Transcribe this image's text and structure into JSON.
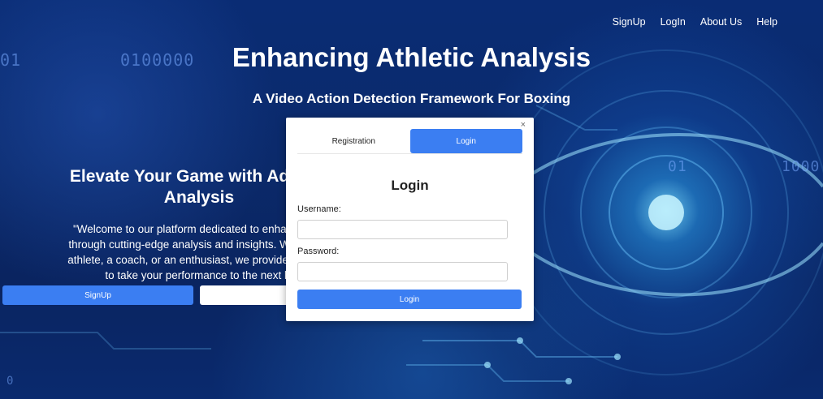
{
  "nav": {
    "items": [
      {
        "label": "SignUp"
      },
      {
        "label": "LogIn"
      },
      {
        "label": "About Us"
      },
      {
        "label": "Help"
      }
    ]
  },
  "header": {
    "title": "Enhancing Athletic Analysis",
    "subtitle": "A Video Action Detection Framework For Boxing"
  },
  "hero": {
    "heading_line1": "Elevate Your Game with Advanc",
    "heading_line2": "Analysis",
    "text_lines": [
      "\"Welcome to our platform dedicated to enhancing at",
      "through cutting-edge analysis and insights. Whether y",
      "athlete, a coach, or an enthusiast, we provide powerfu",
      "to take your performance to the next le"
    ],
    "signup_button": "SignUp",
    "second_button": ""
  },
  "background": {
    "binary_texts": [
      "01",
      "0100000",
      "01",
      "1000",
      "0"
    ]
  },
  "modal": {
    "close": "×",
    "tabs": [
      {
        "label": "Registration",
        "active": false
      },
      {
        "label": "Login",
        "active": true
      }
    ],
    "heading": "Login",
    "username_label": "Username:",
    "username_value": "",
    "password_label": "Password:",
    "password_value": "",
    "submit_label": "Login"
  },
  "colors": {
    "accent": "#3b7ef2",
    "background": "#0a2a6e"
  }
}
